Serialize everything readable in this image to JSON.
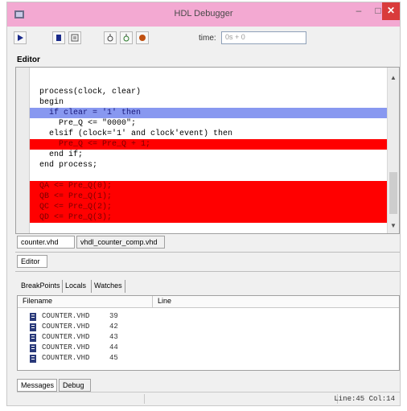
{
  "window": {
    "title": "HDL Debugger",
    "buttons": {
      "minimize": "–",
      "maximize": "□",
      "close": "✕"
    }
  },
  "toolbar": {
    "buttons": [
      "run-icon",
      "stop-icon",
      "step-icon",
      "breakpoint-icon",
      "watch-icon",
      "clear-icon"
    ],
    "time_label": "time:",
    "time_value": "0s + 0"
  },
  "editor": {
    "label": "Editor",
    "lines": [
      {
        "text": "",
        "state": "none"
      },
      {
        "text": "  process(clock, clear)",
        "state": "none"
      },
      {
        "text": "  begin",
        "state": "none"
      },
      {
        "text": "    if clear = '1' then",
        "state": "current"
      },
      {
        "text": "      Pre_Q <= \"0000\";",
        "state": "none"
      },
      {
        "text": "    elsif (clock='1' and clock'event) then",
        "state": "none"
      },
      {
        "text": "      Pre_Q <= Pre_Q + 1;",
        "state": "breakpoint"
      },
      {
        "text": "    end if;",
        "state": "none"
      },
      {
        "text": "  end process;",
        "state": "none"
      },
      {
        "text": "",
        "state": "none"
      },
      {
        "text": "  QA <= Pre_Q(0);",
        "state": "breakpoint"
      },
      {
        "text": "  QB <= Pre_Q(1);",
        "state": "breakpoint"
      },
      {
        "text": "  QC <= Pre_Q(2);",
        "state": "breakpoint"
      },
      {
        "text": "  QD <= Pre_Q(3);",
        "state": "breakpoint"
      }
    ],
    "file_tabs": [
      "counter.vhd",
      "vhdl_counter_comp.vhd"
    ],
    "bottom_tab": "Editor"
  },
  "breakpoints_panel": {
    "tabs": [
      "BreakPoints",
      "Locals",
      "Watches"
    ],
    "columns": {
      "filename": "Filename",
      "line": "Line"
    },
    "rows": [
      {
        "file": "COUNTER.VHD",
        "line": "39"
      },
      {
        "file": "COUNTER.VHD",
        "line": "42"
      },
      {
        "file": "COUNTER.VHD",
        "line": "43"
      },
      {
        "file": "COUNTER.VHD",
        "line": "44"
      },
      {
        "file": "COUNTER.VHD",
        "line": "45"
      }
    ]
  },
  "bottom_tabs": [
    "Messages",
    "Debug"
  ],
  "status": {
    "position": "Line:45 Col:14"
  },
  "colors": {
    "breakpoint": "#ff0000",
    "current_line": "#8898f0",
    "titlebar": "#f3a9d2",
    "close": "#d93b3b"
  }
}
